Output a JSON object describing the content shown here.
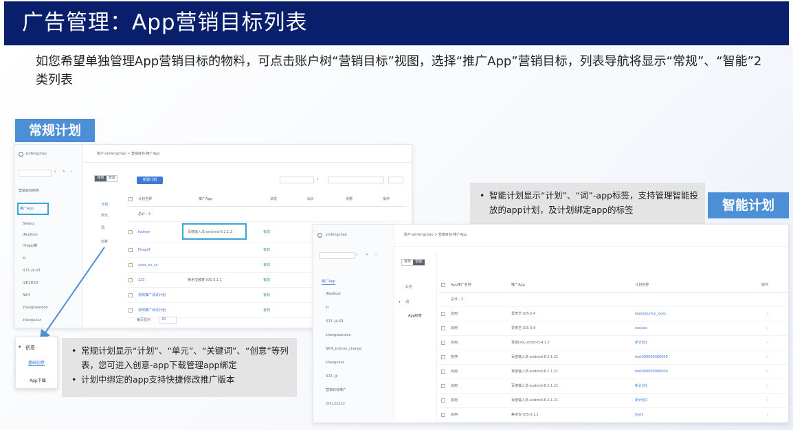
{
  "slide": {
    "title": "广告管理：App营销目标列表",
    "intro": "如您希望单独管理App营销目标的物料，可点击账户树“营销目标”视图，选择“推广App”营销目标，列表导航将显示“常规”、“智能”2类列表"
  },
  "badges": {
    "normal": "常规计划",
    "smart": "智能计划"
  },
  "callouts": {
    "normal": [
      "常规计划显示“计划”、“单元”、“关键词”、“创意”等列表，您可进入创意-app下载管理app绑定",
      "计划中绑定的app支持快捷修改推广版本"
    ],
    "smart": [
      "智能计划显示“计划”、“词”-app标签，支持管理智能投放的app计划，及计划绑定app的标签"
    ]
  },
  "normal_window": {
    "account": "xinfengchao",
    "breadcrumb": "账户-xinfengchao > 营销目标-推广App",
    "tree_items": [
      "推广App",
      "Sheets",
      "iRooltool",
      "Hnapp推",
      "ki",
      "ICI3 -jk-S3",
      "I2D2D2D",
      "Nit4",
      "zhangcoondon",
      "zhangxxxx"
    ],
    "tree_header": "营销目标结构",
    "toggle": [
      "常规",
      "智能"
    ],
    "new_button": "新建计划",
    "side_tabs": [
      "计划",
      "单元",
      "词",
      "创意"
    ],
    "columns": [
      "计划名称",
      "推广App",
      "状态",
      "出价",
      "余额",
      "操作"
    ],
    "rows": [
      {
        "name": "总计 - 2",
        "app": "",
        "status": ""
      },
      {
        "name": "fooleer",
        "app": "百度输入法-android-6.2.1.2",
        "status": "有效"
      },
      {
        "name": "Progoff",
        "app": "",
        "status": "有效"
      },
      {
        "name": "xxxx_xx_xx",
        "app": "",
        "status": "有效"
      },
      {
        "name": "123",
        "app": "美术宝教育-iOS-3.1.1",
        "status": "有效"
      },
      {
        "name": "常规推广测试计划",
        "app": "",
        "status": "有效"
      },
      {
        "name": "常规推广测试计划",
        "app": "",
        "status": "有效"
      }
    ],
    "pager": "每页显示",
    "page_size": "20"
  },
  "zoom_popup": {
    "parent": "创意",
    "items": [
      "基础创意",
      "App下载"
    ]
  },
  "smart_window": {
    "account": "xinfengchao",
    "breadcrumb": "账户-xinfengchao > 营销目标-推广App",
    "toggle": [
      "常规",
      "智能"
    ],
    "tree_header": "推广App",
    "tree_items": [
      "iRooltool",
      "ki",
      "ICI3 -jk-S3",
      "zhangcoondon",
      "Nit4_anticon_change",
      "zhangxxxx",
      "ICI3 -jk",
      "营销目标推广",
      "Drk122222"
    ],
    "side_tabs": [
      "计划",
      "词",
      "App标签"
    ],
    "columns": [
      "App推广名称",
      "推广App",
      "计划名称",
      "操作"
    ],
    "rows": [
      {
        "name": "总计 - 2",
        "app": "",
        "plan": ""
      },
      {
        "name": "启用",
        "app": "爱奇艺-iOS-3.4",
        "plan": "iaqiyigjuntui_xxxx"
      },
      {
        "name": "启用",
        "app": "爱奇艺-iOS-3.4",
        "plan": "xxxxxx"
      },
      {
        "name": "启用",
        "app": "百度DOL-android-4.1.2",
        "plan": "新计划1"
      },
      {
        "name": "暂停",
        "app": "百度输入法-android-6.2.1.21",
        "plan": "test000000000000"
      },
      {
        "name": "启用",
        "app": "百度输入法-android-6.2.1.21",
        "plan": "test000000000000"
      },
      {
        "name": "启用",
        "app": "百度输入法-android-6.2.1.21",
        "plan": "新计划1"
      },
      {
        "name": "启用",
        "app": "百度输入法-android-6.2.1.21",
        "plan": "新计划2"
      },
      {
        "name": "启用",
        "app": "美术宝-iOS-3.1.1",
        "plan": "test1"
      }
    ]
  },
  "colors": {
    "title_bar": "#0a1f6b",
    "badge": "#4d8fd6",
    "link": "#3d7ad6",
    "callout_bg": "#e4e4e4"
  }
}
